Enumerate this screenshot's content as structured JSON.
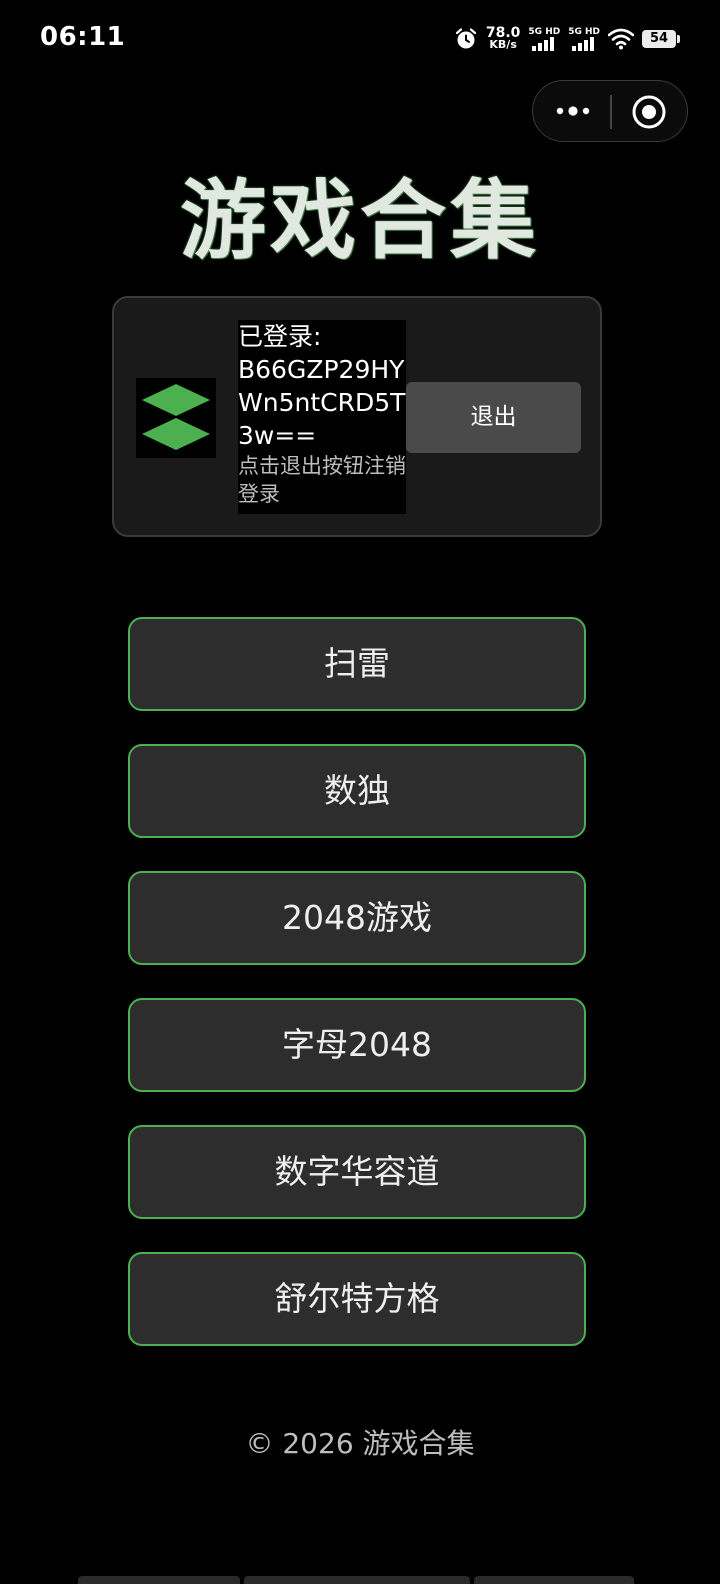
{
  "status_bar": {
    "time": "06:11",
    "net_speed_value": "78.0",
    "net_speed_unit": "KB/s",
    "sim1_label": "5G HD",
    "sim2_label": "5G HD",
    "battery": "54",
    "icons": [
      "alarm-icon",
      "signal-icon",
      "wifi-icon",
      "battery-icon"
    ]
  },
  "capsule": {
    "icons": [
      "more-icon",
      "close-target-icon"
    ]
  },
  "header": {
    "title": "游戏合集"
  },
  "user_card": {
    "login_label": "已登录:",
    "user_id": "B66GZP29HYWn5ntCRD5T3w==",
    "hint": "点击退出按钮注销登录",
    "logout_label": "退出",
    "avatar_icon": "diamond-logo-icon",
    "accent": "#4caf50"
  },
  "games": [
    {
      "label": "扫雷"
    },
    {
      "label": "数独"
    },
    {
      "label": "2048游戏"
    },
    {
      "label": "字母2048"
    },
    {
      "label": "数字华容道"
    },
    {
      "label": "舒尔特方格"
    }
  ],
  "footer": {
    "copyright": "© 2026 游戏合集"
  },
  "colors": {
    "background": "#000000",
    "card": "#1a1a1a",
    "button": "#2d2d2d",
    "button_border": "#4caf50"
  }
}
